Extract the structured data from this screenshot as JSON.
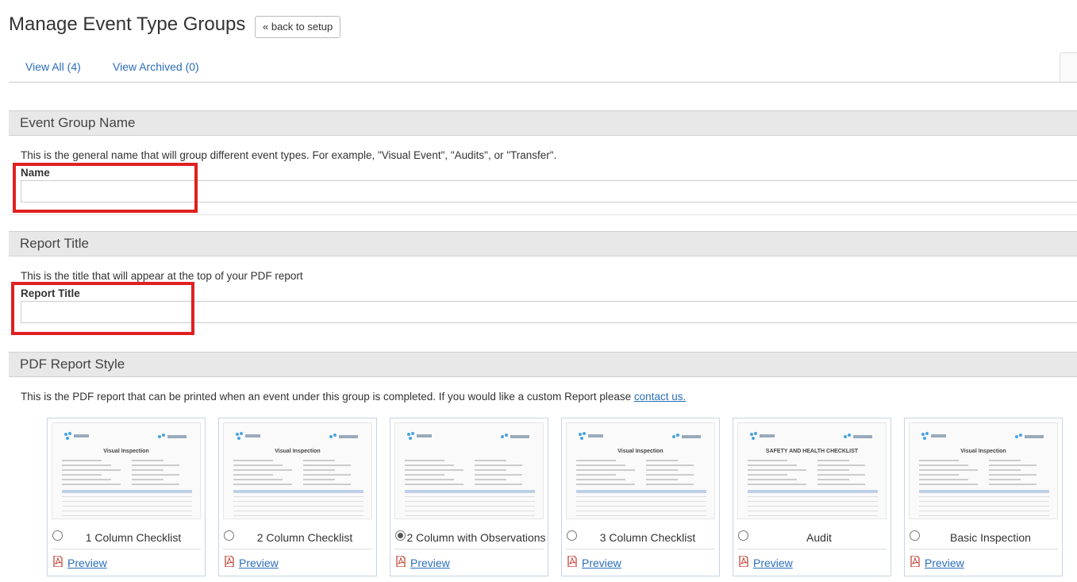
{
  "page": {
    "title": "Manage Event Type Groups",
    "back_button": "« back to setup"
  },
  "tabs": [
    {
      "label": "View All (4)"
    },
    {
      "label": "View Archived (0)"
    }
  ],
  "sections": {
    "event_group": {
      "header": "Event Group Name",
      "description": "This is the general name that will group different event types. For example, \"Visual Event\", \"Audits\", or \"Transfer\".",
      "label": "Name",
      "value": ""
    },
    "report_title": {
      "header": "Report Title",
      "description": "This is the title that will appear at the top of your PDF report",
      "label": "Report Title",
      "value": ""
    },
    "pdf_style": {
      "header": "PDF Report Style",
      "description": "This is the PDF report that can be printed when an event under this group is completed. If you would like a custom Report please ",
      "contact_link": "contact us."
    }
  },
  "report_styles": [
    {
      "name": "1 Column Checklist",
      "preview": "Preview",
      "selected": false,
      "doc_title": "Visual Inspection"
    },
    {
      "name": "2 Column Checklist",
      "preview": "Preview",
      "selected": false,
      "doc_title": "Visual Inspection"
    },
    {
      "name": "2 Column with Observations",
      "preview": "Preview",
      "selected": true,
      "doc_title": ""
    },
    {
      "name": "3 Column Checklist",
      "preview": "Preview",
      "selected": false,
      "doc_title": "Visual Inspection"
    },
    {
      "name": "Audit",
      "preview": "Preview",
      "selected": false,
      "doc_title": "SAFETY AND HEALTH CHECKLIST"
    },
    {
      "name": "Basic Inspection",
      "preview": "Preview",
      "selected": false,
      "doc_title": "Visual Inspection"
    }
  ],
  "colors": {
    "link": "#2a6ebb",
    "highlight": "#e02020",
    "section_bg": "#e8e8e8"
  }
}
